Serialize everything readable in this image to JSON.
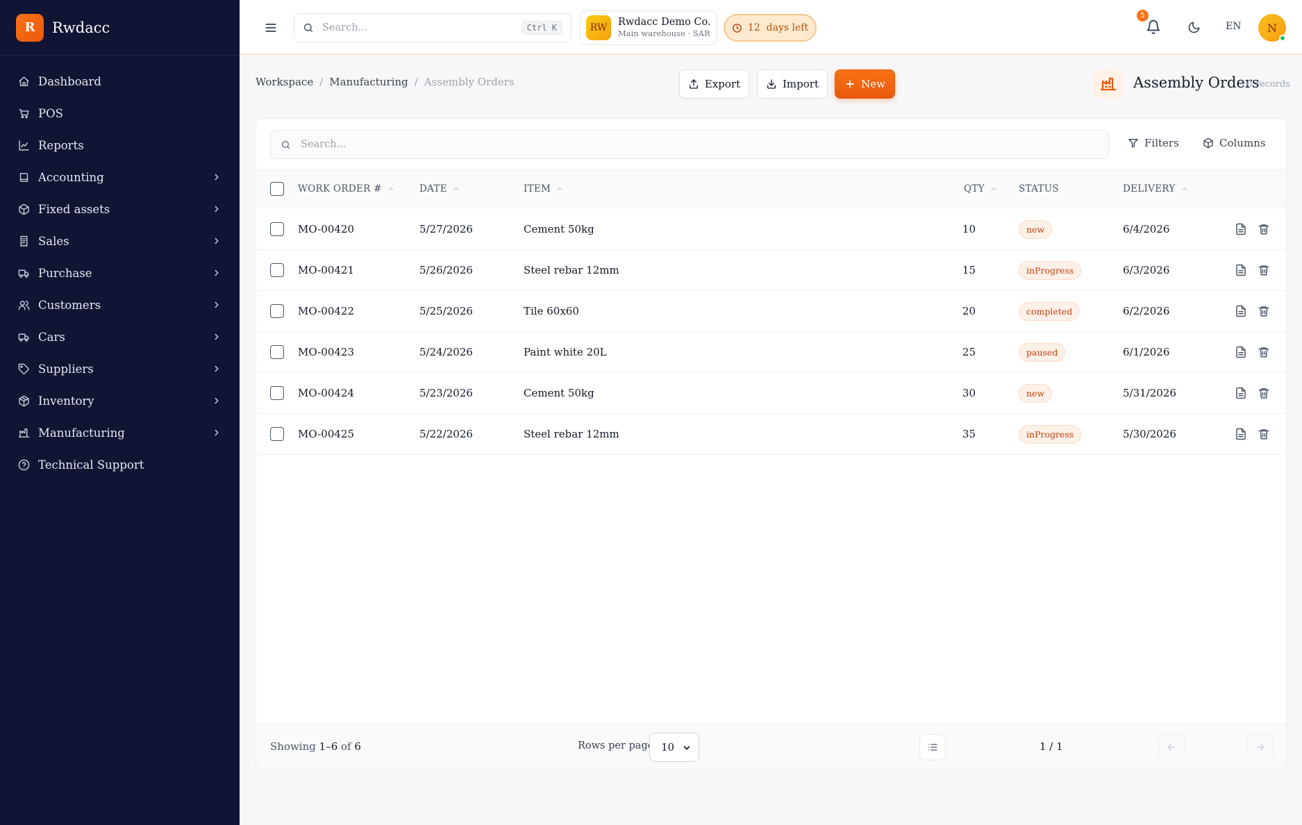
{
  "brand": {
    "logo_letter": "R",
    "name": "Rwdacc"
  },
  "sidebar": {
    "items": [
      {
        "label": "Dashboard",
        "icon": "home-icon",
        "has_children": false
      },
      {
        "label": "POS",
        "icon": "cart-icon",
        "has_children": false
      },
      {
        "label": "Reports",
        "icon": "chart-line-icon",
        "has_children": false
      },
      {
        "label": "Accounting",
        "icon": "book-icon",
        "has_children": true
      },
      {
        "label": "Fixed assets",
        "icon": "cube-icon",
        "has_children": true
      },
      {
        "label": "Sales",
        "icon": "receipt-icon",
        "has_children": true
      },
      {
        "label": "Purchase",
        "icon": "truck-icon",
        "has_children": true
      },
      {
        "label": "Customers",
        "icon": "users-icon",
        "has_children": true
      },
      {
        "label": "Cars",
        "icon": "truck-icon",
        "has_children": true
      },
      {
        "label": "Suppliers",
        "icon": "tag-icon",
        "has_children": true
      },
      {
        "label": "Inventory",
        "icon": "package-icon",
        "has_children": true
      },
      {
        "label": "Manufacturing",
        "icon": "factory-icon",
        "has_children": true
      },
      {
        "label": "Technical Support",
        "icon": "help-circle-icon",
        "has_children": false
      }
    ]
  },
  "topbar": {
    "search_placeholder": "Search...",
    "search_shortcut": "Ctrl K",
    "company_initials": "RW",
    "company_name": "Rwdacc Demo Co.",
    "company_sub": "Main warehouse · SAR",
    "trial_text": "12  days left",
    "notifications_count": "5",
    "language": "EN",
    "avatar_letter": "N"
  },
  "breadcrumb": {
    "items": [
      "Workspace",
      "Manufacturing"
    ],
    "current": "Assembly Orders"
  },
  "actions": {
    "export_label": "Export",
    "import_label": "Import",
    "new_label": "New"
  },
  "page": {
    "title": "Assembly Orders",
    "count": "· 6 records"
  },
  "table": {
    "search_placeholder": "Search...",
    "filters_label": "Filters",
    "columns_label": "Columns",
    "headers": {
      "work_order": "WORK ORDER #",
      "date": "DATE",
      "item": "ITEM",
      "qty": "QTY",
      "status": "STATUS",
      "delivery": "DELIVERY"
    },
    "rows": [
      {
        "work_order": "MO-00420",
        "date": "5/27/2026",
        "item": "Cement 50kg",
        "qty": "10",
        "status": "new",
        "delivery": "6/4/2026"
      },
      {
        "work_order": "MO-00421",
        "date": "5/26/2026",
        "item": "Steel rebar 12mm",
        "qty": "15",
        "status": "inProgress",
        "delivery": "6/3/2026"
      },
      {
        "work_order": "MO-00422",
        "date": "5/25/2026",
        "item": "Tile 60x60",
        "qty": "20",
        "status": "completed",
        "delivery": "6/2/2026"
      },
      {
        "work_order": "MO-00423",
        "date": "5/24/2026",
        "item": "Paint white 20L",
        "qty": "25",
        "status": "paused",
        "delivery": "6/1/2026"
      },
      {
        "work_order": "MO-00424",
        "date": "5/23/2026",
        "item": "Cement 50kg",
        "qty": "30",
        "status": "new",
        "delivery": "5/31/2026"
      },
      {
        "work_order": "MO-00425",
        "date": "5/22/2026",
        "item": "Steel rebar 12mm",
        "qty": "35",
        "status": "inProgress",
        "delivery": "5/30/2026"
      }
    ]
  },
  "footer": {
    "showing_prefix": "Showing",
    "showing_range": "1–6",
    "showing_of": "of",
    "showing_total": "6",
    "rows_per_page_label": "Rows per page",
    "rows_per_page_value": "10",
    "page_indicator": "1 / 1"
  },
  "colors": {
    "accent": "#f97316",
    "sidebar_bg": "#111433",
    "badge_text": "#c2410c"
  }
}
